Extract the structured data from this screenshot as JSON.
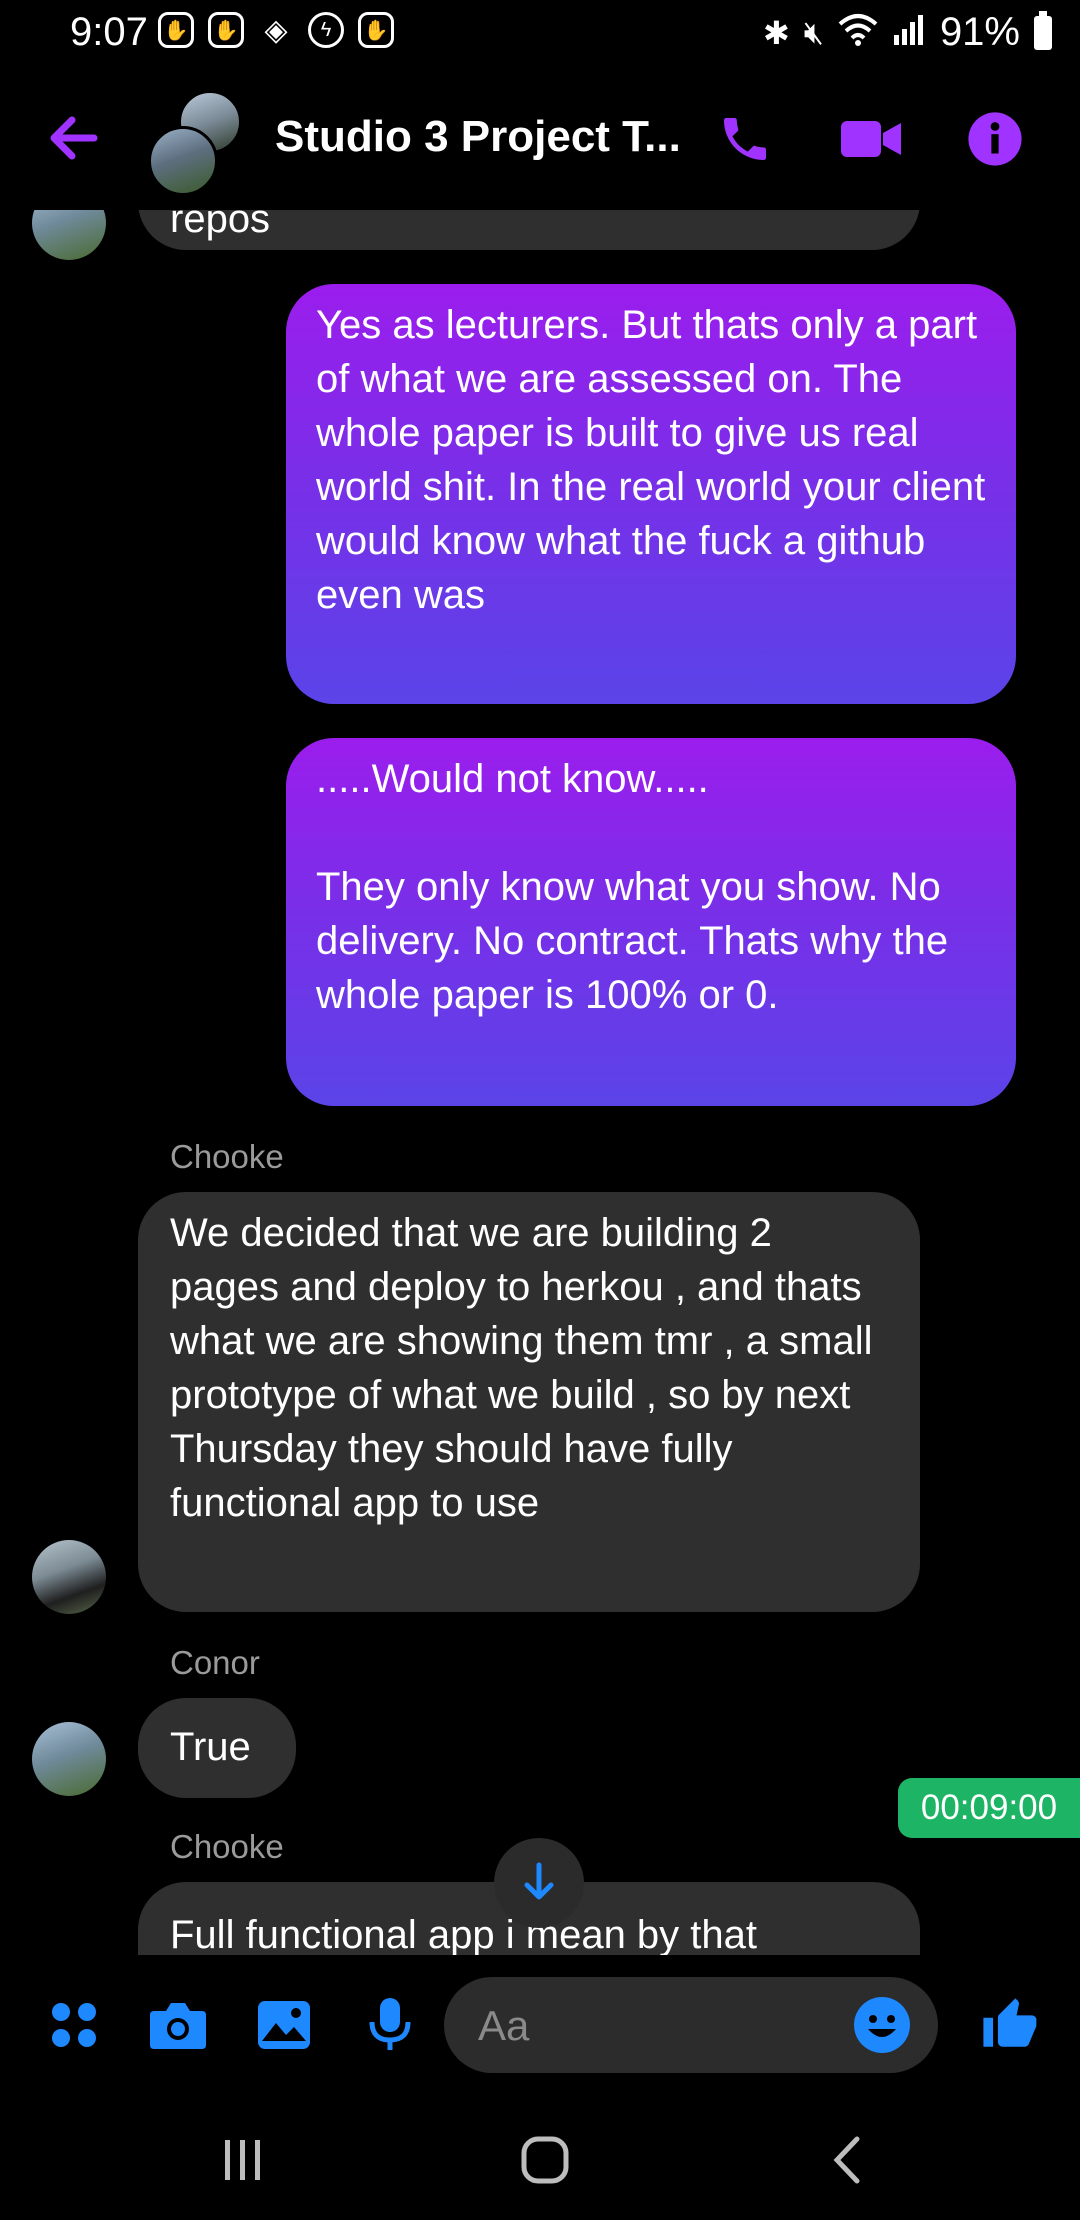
{
  "status_bar": {
    "time": "9:07",
    "battery": "91%"
  },
  "header": {
    "title": "Studio 3 Project T..."
  },
  "messages": [
    {
      "text": "repos"
    },
    {
      "text": "Yes as lecturers. But thats only a part of what we are assessed on. The whole paper is built to give us real world shit. In the real world your client would know what the fuck a github even was"
    },
    {
      "text": ".....Would not know.....\n\nThey only know what you show. No delivery. No contract. Thats why the whole paper is 100% or 0."
    },
    {
      "sender": "Chooke",
      "text": "We decided that we are building 2 pages and deploy to herkou , and thats what we are showing them tmr , a small prototype of what we build , so by next Thursday they should have fully functional app to use"
    },
    {
      "sender": "Conor",
      "text": "True"
    },
    {
      "sender": "Chooke",
      "text": "Full functional app i mean by that"
    }
  ],
  "timer": "00:09:00",
  "composer": {
    "placeholder": "Aa"
  },
  "colors": {
    "accent": "#a033ff",
    "blue": "#1e88ff",
    "timer_green": "#1db565",
    "incoming_bubble": "#2f2f2f"
  },
  "icons": [
    "back-arrow-icon",
    "phone-icon",
    "video-icon",
    "info-icon",
    "apps-icon",
    "camera-icon",
    "gallery-icon",
    "microphone-icon",
    "emoji-icon",
    "thumbs-up-icon",
    "arrow-down-icon"
  ]
}
